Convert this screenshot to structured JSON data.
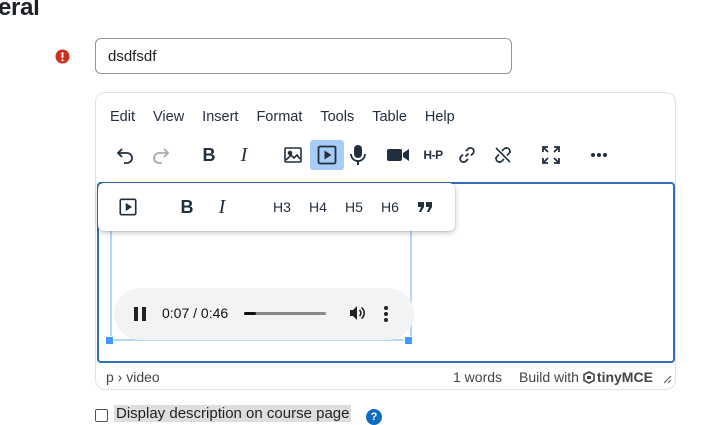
{
  "section": {
    "title": "eral"
  },
  "name_field": {
    "value": "dsdfsdf"
  },
  "menubar": {
    "items": [
      "Edit",
      "View",
      "Insert",
      "Format",
      "Tools",
      "Table",
      "Help"
    ]
  },
  "toolbar": {
    "bold": "B",
    "italic": "I",
    "h5p": "H-P"
  },
  "audio": {
    "time": "0:07 / 0:46",
    "progress": 0.152
  },
  "quickbar": {
    "bold": "B",
    "italic": "I",
    "h3": "H3",
    "h4": "H4",
    "h5": "H5",
    "h6": "H6"
  },
  "statusbar": {
    "path": "p › video",
    "words": "1 words",
    "build_with": "Build with",
    "brand": "tinyMCE"
  },
  "footer": {
    "checkbox_label": "Display description on course page"
  },
  "colors": {
    "accent": "#2e6fb7",
    "active_button": "#a6ccf7",
    "required": "#ca3120",
    "help": "#0f6cbf"
  }
}
